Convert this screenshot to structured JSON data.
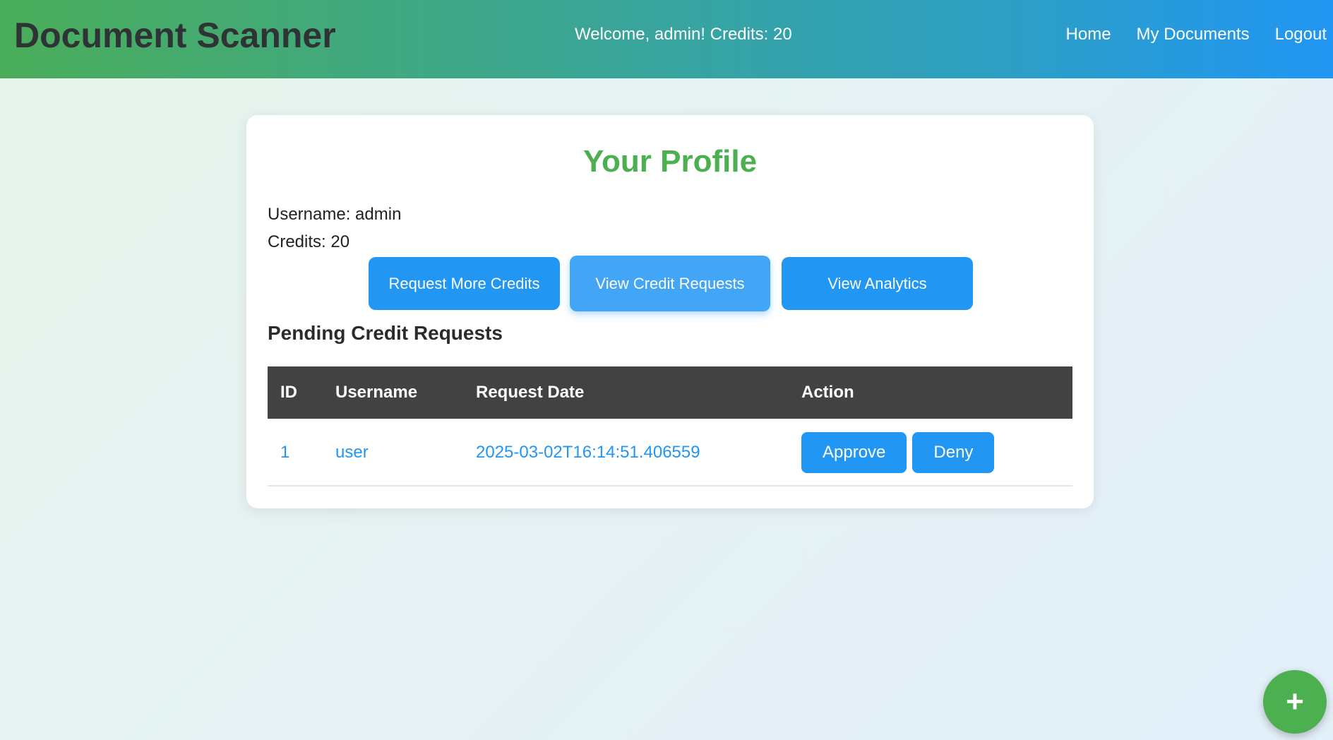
{
  "header": {
    "brand": "Document Scanner",
    "welcome": "Welcome, admin! Credits: 20",
    "nav": [
      {
        "label": "Home"
      },
      {
        "label": "My Documents"
      },
      {
        "label": "Logout"
      }
    ]
  },
  "profile": {
    "title": "Your Profile",
    "username_line": "Username: admin",
    "credits_line": "Credits: 20",
    "buttons": {
      "request_credits": "Request More Credits",
      "view_requests": "View Credit Requests",
      "view_analytics": "View Analytics"
    }
  },
  "pending": {
    "title": "Pending Credit Requests",
    "columns": [
      "ID",
      "Username",
      "Request Date",
      "Action"
    ],
    "rows": [
      {
        "id": "1",
        "username": "user",
        "request_date": "2025-03-02T16:14:51.406559",
        "approve_label": "Approve",
        "deny_label": "Deny"
      }
    ]
  },
  "fab": {
    "icon": "plus-icon",
    "glyph": "+"
  },
  "colors": {
    "accent_blue": "#2196f3",
    "accent_green": "#4caf50",
    "table_header": "#424242"
  }
}
